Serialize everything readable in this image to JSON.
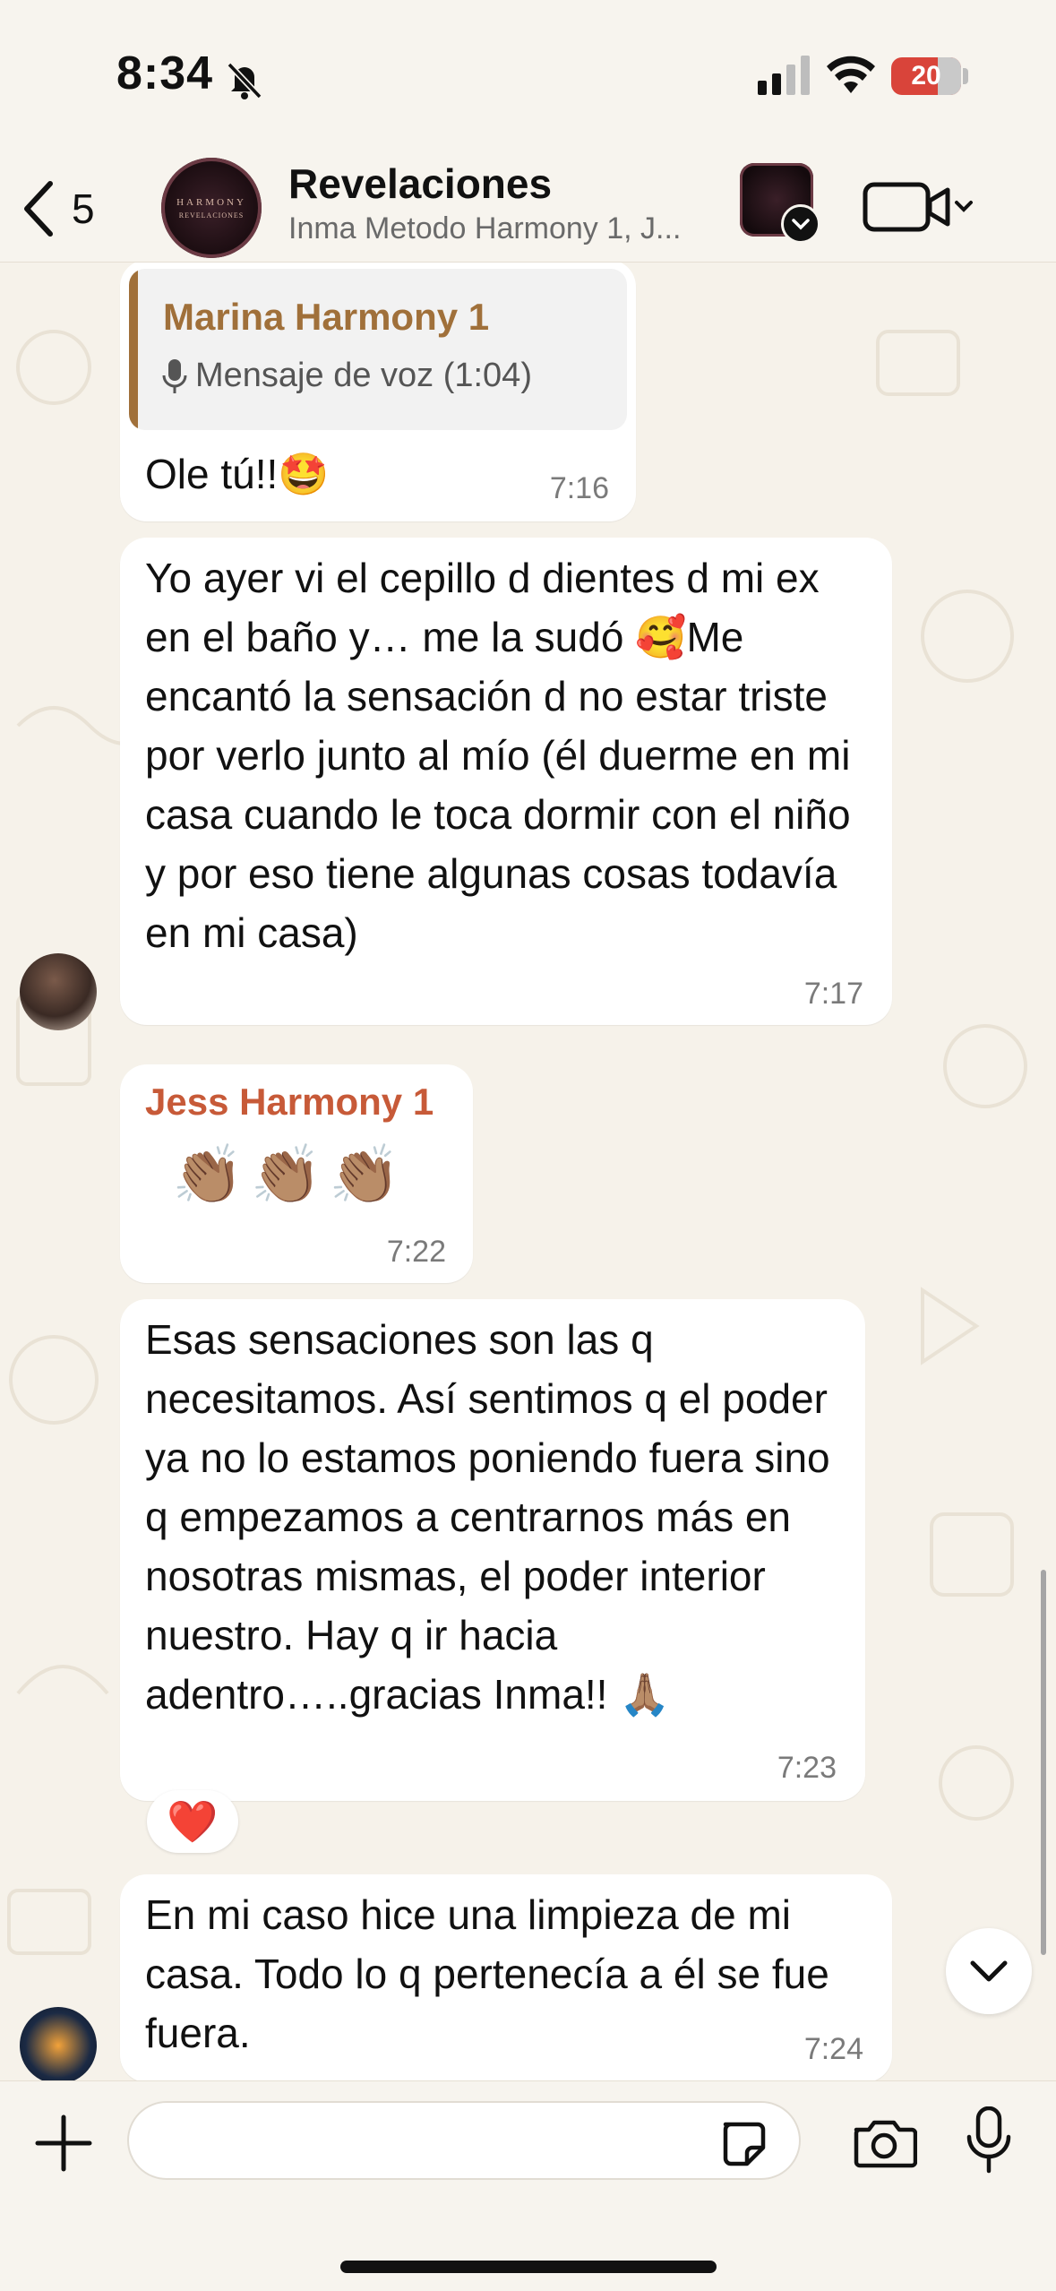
{
  "status_bar": {
    "time": "8:34",
    "battery": "20"
  },
  "header": {
    "back_count": "5",
    "group_name": "Revelaciones",
    "members": "Inma Metodo Harmony 1, J...",
    "avatar_line1": "HARMONY",
    "avatar_line2": "REVELACIONES"
  },
  "messages": [
    {
      "quote_name": "Marina Harmony 1",
      "quote_text": "Mensaje de voz (1:04)",
      "text": "Ole tú!!🤩",
      "time": "7:16"
    },
    {
      "text": "Yo ayer vi el cepillo d dientes d mi ex en el baño y… me la sudó 🥰Me encantó la sensación d no estar triste por verlo junto al mío (él duerme en mi casa cuando le toca dormir con el niño y por eso tiene algunas cosas todavía en mi casa)",
      "time": "7:17"
    },
    {
      "sender": "Jess Harmony 1",
      "sender_color": "#c75a38",
      "text": "👏🏽👏🏽👏🏽",
      "time": "7:22"
    },
    {
      "text": "Esas sensaciones son las q necesitamos. Así sentimos q el poder ya no lo estamos poniendo fuera sino q empezamos a centrarnos más en nosotras mismas, el poder interior nuestro. Hay q ir hacia adentro…..gracias Inma!! 🙏🏽",
      "time": "7:23",
      "reaction": "❤️"
    },
    {
      "text": "En mi caso hice una limpieza de mi casa. Todo lo q pertenecía a él se fue fuera.",
      "time": "7:24"
    }
  ],
  "composer": {
    "placeholder": ""
  },
  "colors": {
    "background": "#f6f2ea",
    "bubble": "#ffffff",
    "quote_accent": "#a0703a",
    "sender_accent": "#c75a38"
  }
}
